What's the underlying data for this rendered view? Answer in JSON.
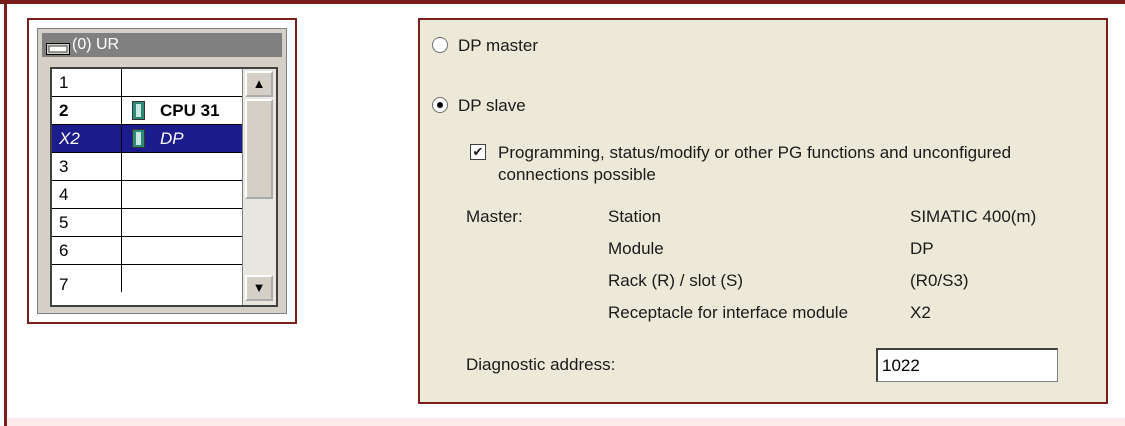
{
  "rack": {
    "title": "(0) UR",
    "rows": [
      {
        "slot": "1",
        "module": ""
      },
      {
        "slot": "2",
        "module": "CPU 31"
      },
      {
        "slot": "X2",
        "module": "DP"
      },
      {
        "slot": "3",
        "module": ""
      },
      {
        "slot": "4",
        "module": ""
      },
      {
        "slot": "5",
        "module": ""
      },
      {
        "slot": "6",
        "module": ""
      },
      {
        "slot": "7",
        "module": ""
      }
    ],
    "scroll_up": "▲",
    "scroll_down": "▼"
  },
  "props": {
    "dp_master_label": "DP master",
    "dp_slave_label": "DP slave",
    "pg_functions_line1": "Programming, status/modify or other PG functions and unconfigured",
    "pg_functions_line2": "connections possible",
    "master_label": "Master:",
    "station_label": "Station",
    "station_value": "SIMATIC 400(m)",
    "module_label": "Module",
    "module_value": "DP",
    "rack_slot_label": "Rack (R) / slot (S)",
    "rack_slot_value": "(R0/S3)",
    "receptacle_label": "Receptacle for interface module",
    "receptacle_value": "X2",
    "diag_label": "Diagnostic address:",
    "diag_value": "1022",
    "checkmark": "✔"
  },
  "colors": {
    "frame": "#7a1d1d",
    "selection": "#1c1c8c",
    "panel_bg": "#ece9d8"
  }
}
